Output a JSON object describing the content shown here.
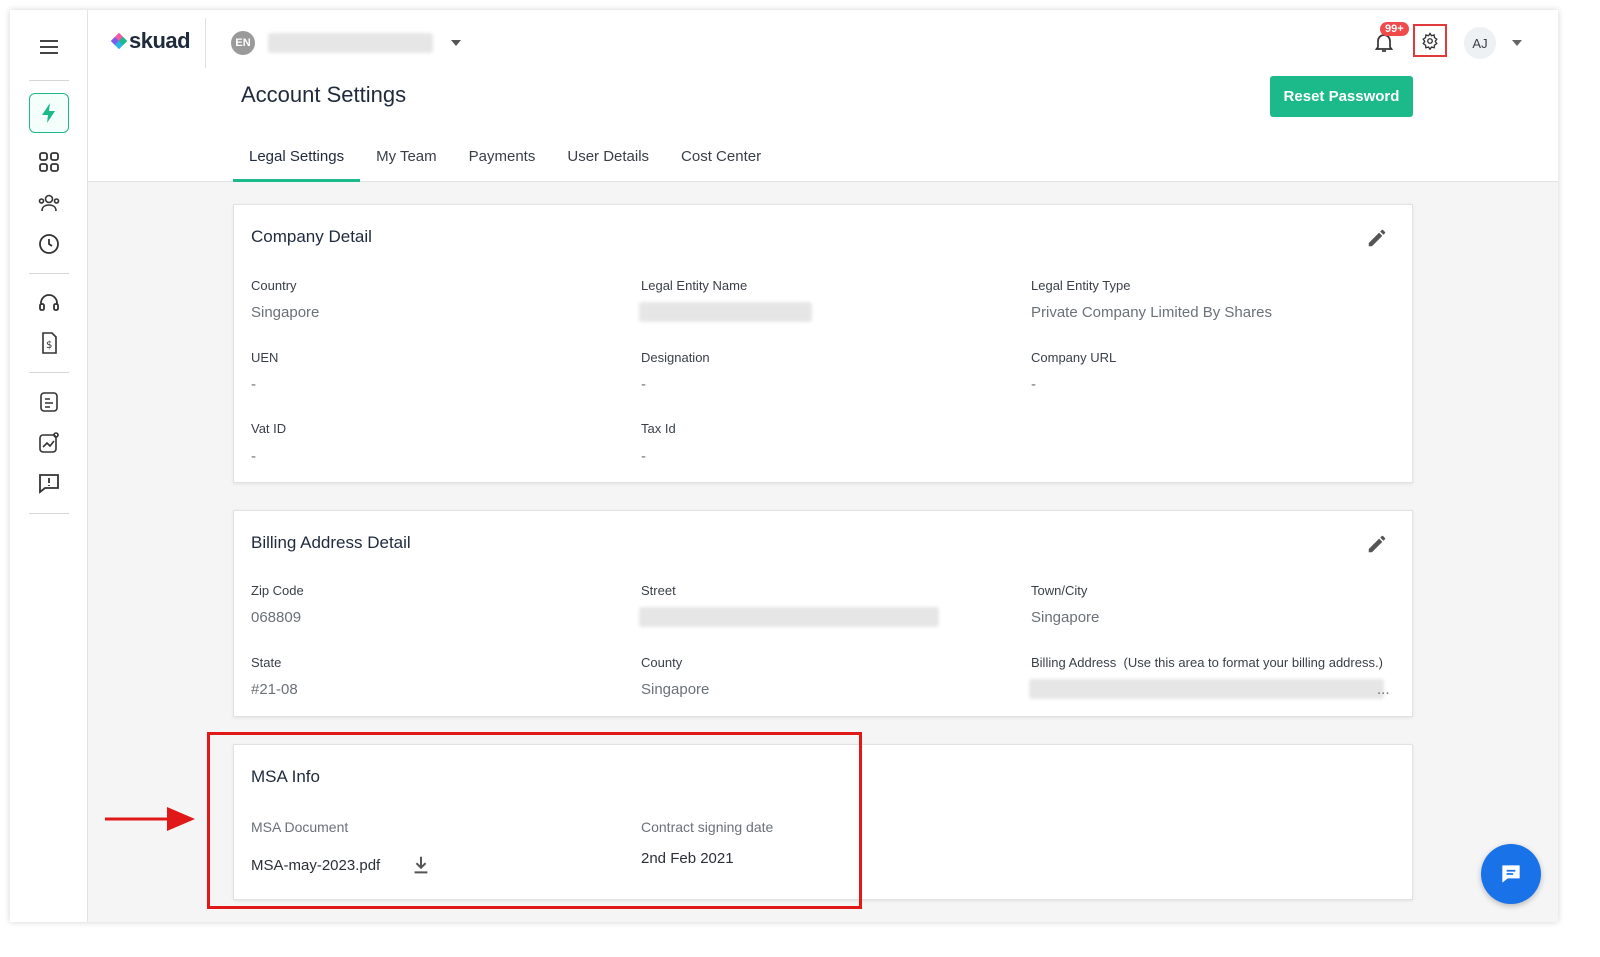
{
  "app": {
    "brand": "skuad",
    "lang_badge": "EN",
    "colors": {
      "accent": "#1cb98a",
      "alert": "#ef4b4b",
      "highlight": "#e11818",
      "chat": "#1a72e8"
    }
  },
  "header": {
    "title": "Account Settings",
    "reset_label": "Reset Password",
    "notifications_count": "99+",
    "avatar_initials": "AJ"
  },
  "tabs": [
    {
      "label": "Legal Settings",
      "active": true
    },
    {
      "label": "My Team"
    },
    {
      "label": "Payments"
    },
    {
      "label": "User Details"
    },
    {
      "label": "Cost Center"
    }
  ],
  "company": {
    "title": "Company Detail",
    "fields": [
      {
        "label": "Country",
        "value": "Singapore"
      },
      {
        "label": "Legal Entity Name",
        "value": ""
      },
      {
        "label": "Legal Entity Type",
        "value": "Private Company Limited By Shares"
      },
      {
        "label": "UEN",
        "value": "-"
      },
      {
        "label": "Designation",
        "value": "-"
      },
      {
        "label": "Company URL",
        "value": "-"
      },
      {
        "label": "Vat ID",
        "value": "-"
      },
      {
        "label": "Tax Id",
        "value": "-"
      }
    ]
  },
  "billing": {
    "title": "Billing Address Detail",
    "fields": [
      {
        "label": "Zip Code",
        "value": "068809"
      },
      {
        "label": "Street",
        "value": ""
      },
      {
        "label": "Town/City",
        "value": "Singapore"
      },
      {
        "label": "State",
        "value": "#21-08"
      },
      {
        "label": "County",
        "value": "Singapore"
      },
      {
        "label": "Billing Address",
        "value": "..."
      }
    ],
    "billing_hint": "(Use this area to format your billing address.)"
  },
  "msa": {
    "title": "MSA Info",
    "doc_label": "MSA Document",
    "doc_file": "MSA-may-2023.pdf",
    "date_label": "Contract signing date",
    "date_value": "2nd Feb 2021"
  },
  "icons": [
    "menu-icon",
    "bolt-icon",
    "grid-icon",
    "people-icon",
    "clock-icon",
    "headset-icon",
    "invoice-icon",
    "document-icon",
    "analytics-icon",
    "feedback-icon",
    "bell-icon",
    "gear-icon",
    "pencil-icon",
    "download-icon",
    "chat-icon"
  ]
}
